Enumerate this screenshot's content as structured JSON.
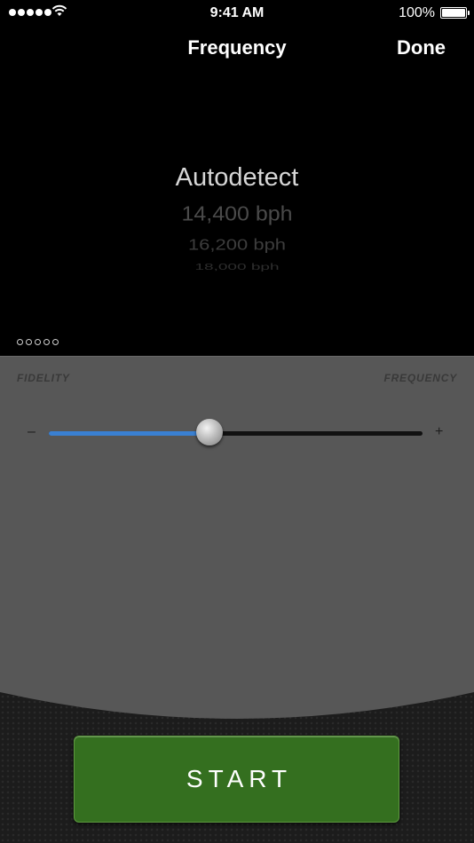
{
  "status_bar": {
    "time": "9:41 AM",
    "battery_text": "100%",
    "signal_dots": 5,
    "battery_level": 1.0
  },
  "nav": {
    "title": "Frequency",
    "done_label": "Done"
  },
  "picker": {
    "items": [
      "Autodetect",
      "14,400 bph",
      "16,200 bph",
      "18,000 bph"
    ],
    "selected": "Autodetect"
  },
  "page_indicator": {
    "count": 5
  },
  "settings": {
    "left_label": "FIDELITY",
    "right_label": "FREQUENCY",
    "minus_symbol": "–",
    "plus_symbol": "+",
    "slider_value": 0.43,
    "slider_color": "#3a80d2"
  },
  "start_button": {
    "label": "START",
    "color": "#346f1f"
  }
}
